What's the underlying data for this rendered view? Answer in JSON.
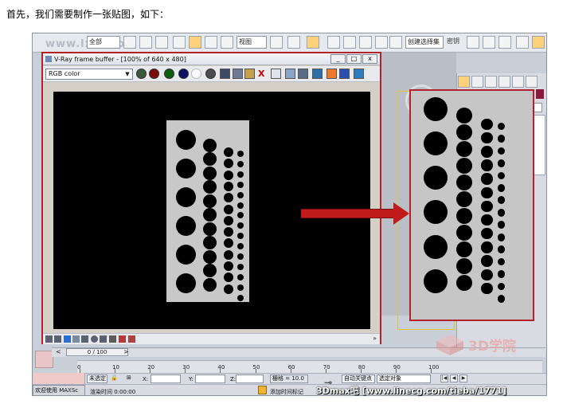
{
  "intro_text": "首先，我们需要制作一张贴图，如下：",
  "toolbar": {
    "watermark": "www.lxxt.com",
    "selection_filter": "全部",
    "view_select": "视图",
    "create_selection_set": "创建选择集",
    "named_label": "密钥"
  },
  "vfb": {
    "title": "V-Ray frame buffer - [100% of 640 x 480]",
    "minimize": "_",
    "maximize": "□",
    "close": "x",
    "channel": "RGB color",
    "toolbar_icons": [
      "render-icon",
      "red-channel-icon",
      "green-channel-icon",
      "blue-channel-icon",
      "alpha-icon",
      "mono-icon",
      "save-icon",
      "save-all-icon",
      "open-icon",
      "clear-icon",
      "duplicate-icon",
      "region-icon",
      "teapot-icon",
      "history-icon",
      "lut-icon",
      "colors-icon",
      "render-settings-icon"
    ],
    "status_icons": [
      "vfb-icon",
      "sequence-icon",
      "info-icon",
      "chart-icon",
      "lut-small-icon",
      "ocio-icon",
      "levels-icon",
      "hdr-icon",
      "stereo-icon",
      "lens-icon"
    ],
    "scroll_arrow": "»"
  },
  "timeline": {
    "frame_label": "0 / 100",
    "prev": "<",
    "next": ">",
    "ticks": [
      "0",
      "10",
      "20",
      "30",
      "40",
      "50",
      "60",
      "70",
      "80",
      "90",
      "100"
    ]
  },
  "statusbar": {
    "not_selected": "未选定",
    "x_label": "X:",
    "y_label": "Y:",
    "z_label": "Z:",
    "grid": "栅格 = 10.0",
    "auto_key": "自动关键点",
    "selected_object": "选定对象",
    "welcome": "欢迎使用 MAXSc",
    "render_time": "渲染时间 0:00:00",
    "add_time_tag": "添加时间标记",
    "key_icon": "key-icon"
  },
  "watermark": {
    "logo_text": "3D学院",
    "url": "3Dmax吧 [www.linecg.com/tieba/1771]"
  },
  "colors": {
    "accent_red": "#b2222a",
    "arrow_red": "#c11a1a",
    "plate_gray": "#c8c8c8"
  }
}
